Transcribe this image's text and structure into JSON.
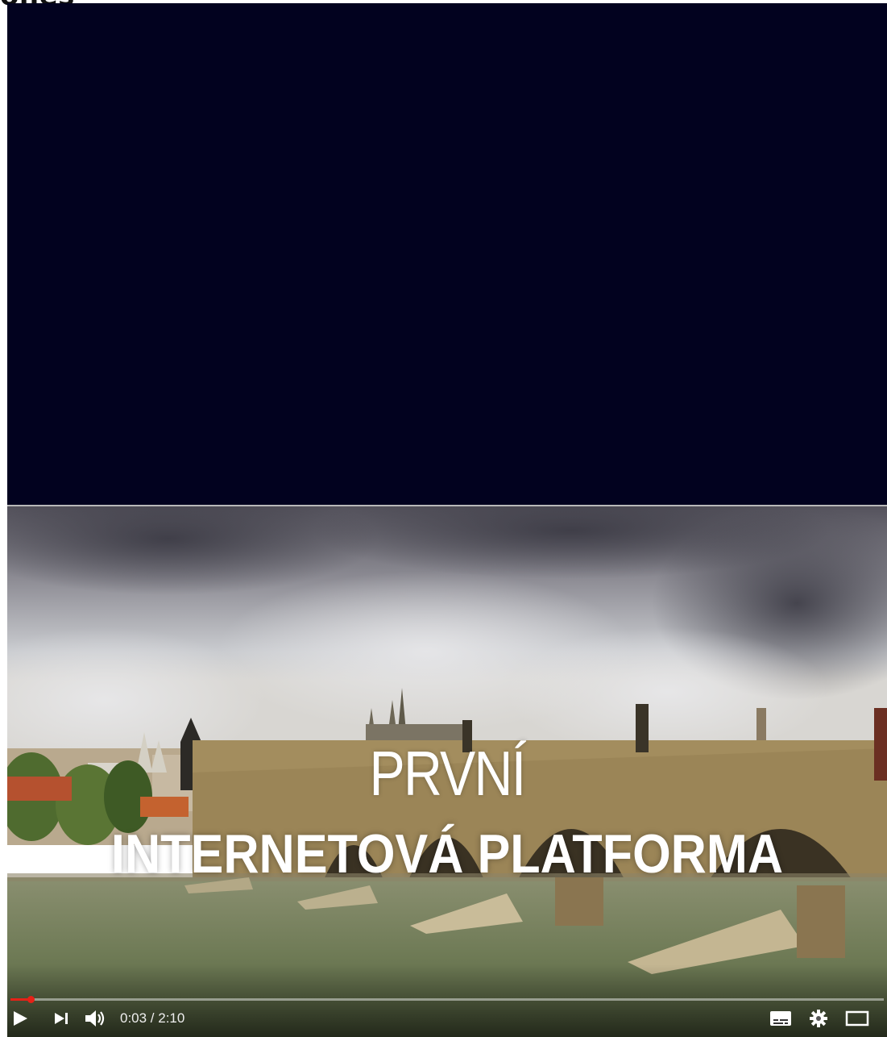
{
  "page": {
    "clipped_heading": "ones"
  },
  "video": {
    "overlay_title_line1": "PRVNÍ",
    "overlay_title_line2": "INTERNETOVÁ PLATFORMA",
    "progress_fraction": 0.023,
    "time_display": "0:03 / 2:10",
    "accent_color": "#e62117"
  },
  "controls": {
    "play": "play-icon",
    "next": "next-icon",
    "volume": "volume-icon",
    "captions": "captions-icon",
    "settings": "gear-icon",
    "theater": "theater-mode-icon"
  },
  "colors": {
    "dark_panel": "#02021f"
  }
}
